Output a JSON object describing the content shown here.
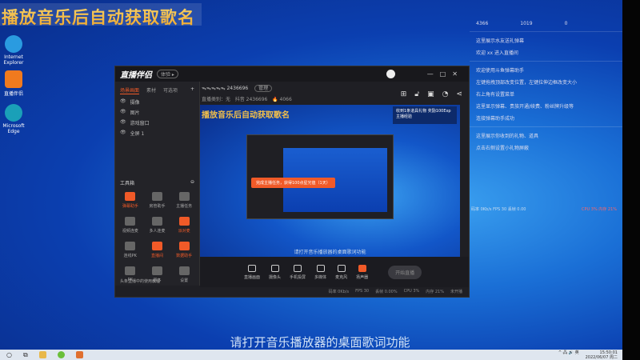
{
  "overlay": {
    "title": "播放音乐后自动获取歌名",
    "subtitle": "请打开音乐播放器的桌面歌词功能"
  },
  "desktop_icons": [
    {
      "label": "Internet Explorer",
      "color": "#2a9be0"
    },
    {
      "label": "直播伴侣",
      "color": "#f07a1e"
    },
    {
      "label": "Microsoft Edge",
      "color": "#1aa0b8"
    }
  ],
  "app": {
    "name": "直播伴侣",
    "badge": "体验 ▸",
    "window_controls": [
      "—",
      "□",
      "✕"
    ],
    "tabs": [
      "场景画面",
      "素材",
      "可选项"
    ],
    "add": "+",
    "scenes": [
      "摄像",
      "图片",
      "游戏窗口",
      "全屏 1"
    ],
    "room": "ᯓᯓᯓᯓᯓ 2436696",
    "room_badge": "管理",
    "category": "直播类别：无",
    "id_label": "抖音 2436696",
    "hot": "🔥 4066",
    "toolbox": "工具箱",
    "tools": [
      {
        "label": "弹幕助手",
        "active": true
      },
      {
        "label": "房管助手",
        "active": false
      },
      {
        "label": "主播任务",
        "active": false
      },
      {
        "label": "视频连麦",
        "active": false
      },
      {
        "label": "多人连麦",
        "active": false
      },
      {
        "label": "派对麦",
        "active": true
      },
      {
        "label": "连线PK",
        "active": false
      },
      {
        "label": "直播间",
        "active": true
      },
      {
        "label": "数据助手",
        "active": true
      },
      {
        "label": "PK",
        "active": false
      },
      {
        "label": "更多",
        "active": false
      },
      {
        "label": "设置",
        "active": false
      }
    ],
    "footer": "头条直播中的使用教程",
    "preview_title": "播放音乐后自动获取歌名",
    "toast": "完成主播任务，获得100点星光值（1天）",
    "gift": "收到1条道具礼物 奖励100Exp 主播经验",
    "preview_sub": "请打开音乐播放器的桌面歌词功能",
    "bottom": [
      "直播画面",
      "摄像头",
      "手机投屏",
      "多媒体",
      "麦克风",
      "扬声器"
    ],
    "start": "开始直播",
    "status": [
      "码率 0Kb/s",
      "FPS 30",
      "丢帧 0.00%",
      "CPU 3%",
      "内存 21%",
      "未开播"
    ]
  },
  "right_panel": {
    "stats": [
      "4366",
      "1019",
      "0"
    ],
    "msgs1": [
      "这里展示水友送礼弹幕",
      "欢迎 xx 进入直播间"
    ],
    "msgs2": [
      "欢迎使用斗鱼弹幕助手",
      "左键拖拽顶部改变位置，左键拉伸边框改变大小",
      "右上角有设置菜单",
      "这里显示弹幕、贵族开通/续费、粉丝牌升级等",
      "连接弹幕助手成功"
    ],
    "msgs3": [
      "这里展示你收到的礼物、道具",
      "点击右侧设置小礼物屏蔽"
    ],
    "status_left": "码率 0Kb/s  FPS 30  丢帧 0.00",
    "status_right": "CPU 3%  内存 21%"
  },
  "taskbar": {
    "time": "15:50:01",
    "date": "2022/06/07 周二",
    "tray": "^ 🖧 🔊 英"
  }
}
